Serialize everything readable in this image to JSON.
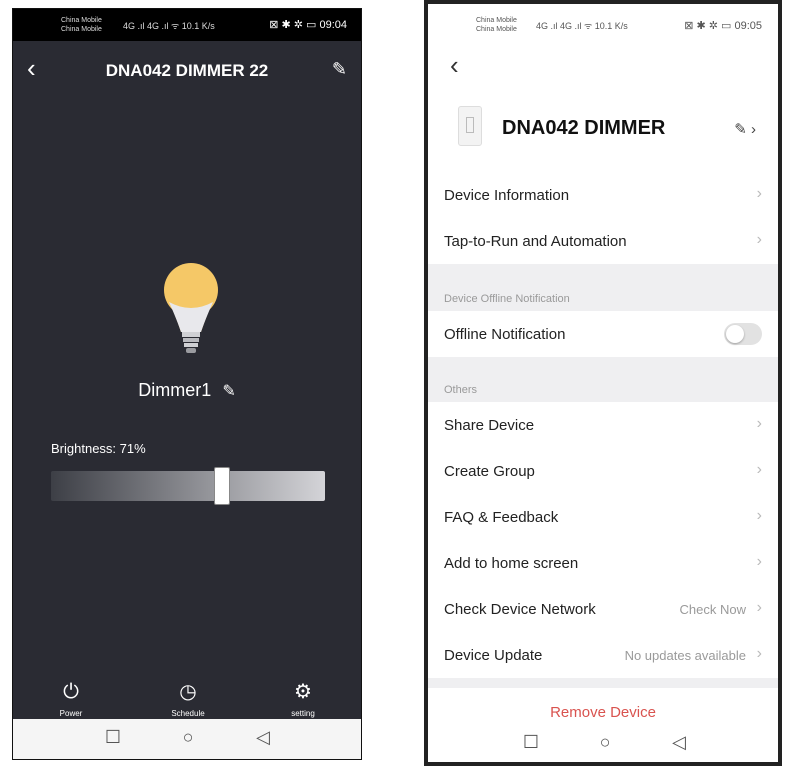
{
  "left": {
    "status": {
      "carrier1": "China Mobile",
      "carrier2": "China Mobile",
      "signal_text": "4G .ıl 4G .ıl ᯤ 10.1 K/s",
      "right_text": "⊠ ✱ ✲ ▭ 09:04",
      "time": "09:04"
    },
    "title": "DNA042 DIMMER 22",
    "dimmer_name": "Dimmer1",
    "brightness_label": "Brightness: 71%",
    "brightness": 71,
    "bottom": [
      {
        "label": "Power",
        "icon": "power-icon"
      },
      {
        "label": "Schedule",
        "icon": "clock-icon"
      },
      {
        "label": "setting",
        "icon": "gear-icon"
      }
    ],
    "colors": {
      "background": "#2a2b33",
      "bulb": "#f5c867"
    }
  },
  "right": {
    "status": {
      "carrier1": "China Mobile",
      "carrier2": "China Mobile",
      "signal_text": "4G .ıl 4G .ıl ᯤ 10.1 K/s",
      "right_text": "⊠ ✱ ✲ ▭ 09:05",
      "time": "09:05"
    },
    "device_name": "DNA042 DIMMER",
    "rows_top": [
      {
        "label": "Device Information"
      },
      {
        "label": "Tap-to-Run and Automation"
      }
    ],
    "section_offline": "Device Offline Notification",
    "offline_row": "Offline Notification",
    "offline_on": false,
    "section_others": "Others",
    "rows_others": [
      {
        "label": "Share Device"
      },
      {
        "label": "Create Group"
      },
      {
        "label": "FAQ & Feedback"
      },
      {
        "label": "Add to home screen"
      },
      {
        "label": "Check Device Network",
        "value": "Check Now"
      },
      {
        "label": "Device Update",
        "value": "No updates available"
      }
    ],
    "remove_label": "Remove Device",
    "colors": {
      "remove": "#d9534f"
    }
  }
}
